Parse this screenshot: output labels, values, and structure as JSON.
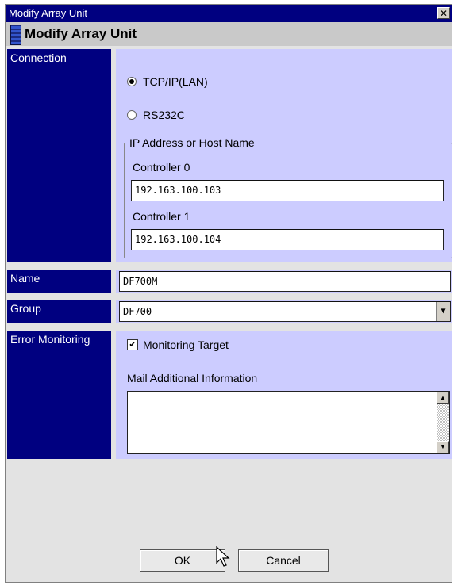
{
  "window": {
    "title": "Modify Array Unit",
    "close_label": "✕"
  },
  "header": {
    "title": "Modify Array Unit"
  },
  "labels": {
    "connection": "Connection",
    "name": "Name",
    "group": "Group",
    "error_monitoring": "Error Monitoring"
  },
  "connection": {
    "option_tcp": "TCP/IP(LAN)",
    "option_rs232c": "RS232C",
    "selected": "TCP/IP(LAN)",
    "group_label": "IP Address or Host Name",
    "controller0_label": "Controller 0",
    "controller0_value": "192.163.100.103",
    "controller1_label": "Controller 1",
    "controller1_value": "192.163.100.104"
  },
  "name": {
    "value": "DF700M"
  },
  "group": {
    "value": "DF700"
  },
  "error_monitoring": {
    "monitoring_target_label": "Monitoring Target",
    "monitoring_target_checked": true,
    "mail_info_label": "Mail Additional Information",
    "mail_info_value": ""
  },
  "buttons": {
    "ok": "OK",
    "cancel": "Cancel"
  },
  "colors": {
    "label_bg": "#000080",
    "panel_bg": "#ccccff",
    "title_bg": "#000080"
  }
}
